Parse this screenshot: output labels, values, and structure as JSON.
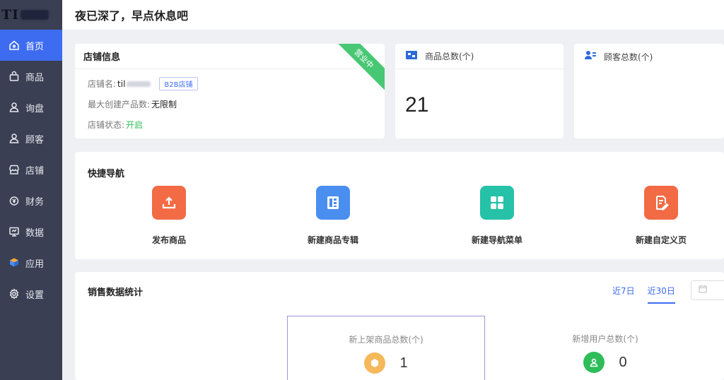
{
  "app": {
    "logo_text": "TI"
  },
  "sidebar": {
    "items": [
      {
        "label": "首页",
        "icon": "home-icon",
        "active": true
      },
      {
        "label": "商品",
        "icon": "bag-icon"
      },
      {
        "label": "询盘",
        "icon": "user-icon"
      },
      {
        "label": "顾客",
        "icon": "user-icon"
      },
      {
        "label": "店铺",
        "icon": "store-icon"
      },
      {
        "label": "财务",
        "icon": "finance-icon"
      },
      {
        "label": "数据",
        "icon": "monitor-icon"
      },
      {
        "label": "应用",
        "icon": "cube-icon"
      },
      {
        "label": "设置",
        "icon": "gear-icon"
      }
    ]
  },
  "header": {
    "greeting": "夜已深了，早点休息吧"
  },
  "store": {
    "title": "店铺信息",
    "ribbon": "营业中",
    "name_label": "店铺名:",
    "name_value": "til",
    "tag": "B2B店铺",
    "max_label": "最大创建产品数:",
    "max_value": "无限制",
    "status_label": "店铺状态:",
    "status_value": "开启",
    "status_color": "#2ebd59"
  },
  "goods_total": {
    "label": "商品总数(个)",
    "value": "21",
    "icon": "goods-icon"
  },
  "customer_total": {
    "label": "顾客总数(个)",
    "icon": "customers-icon"
  },
  "quick_nav": {
    "title": "快捷导航",
    "items": [
      {
        "label": "发布商品",
        "color": "#f26b45",
        "icon": "upload-icon"
      },
      {
        "label": "新建商品专辑",
        "color": "#4a8ef0",
        "icon": "album-icon"
      },
      {
        "label": "新建导航菜单",
        "color": "#25c2a8",
        "icon": "grid-icon"
      },
      {
        "label": "新建自定义页",
        "color": "#f26b45",
        "icon": "edit-page-icon"
      }
    ]
  },
  "sales": {
    "title": "销售数据统计",
    "tabs": [
      {
        "label": "近7日"
      },
      {
        "label": "近30日",
        "active": true
      }
    ],
    "metrics": [
      {
        "label": "新上架商品总数(个)",
        "value": "1",
        "color": "#f5b85a"
      },
      {
        "label": "新增用户总数(个)",
        "value": "0",
        "color": "#2ebd59"
      }
    ]
  }
}
